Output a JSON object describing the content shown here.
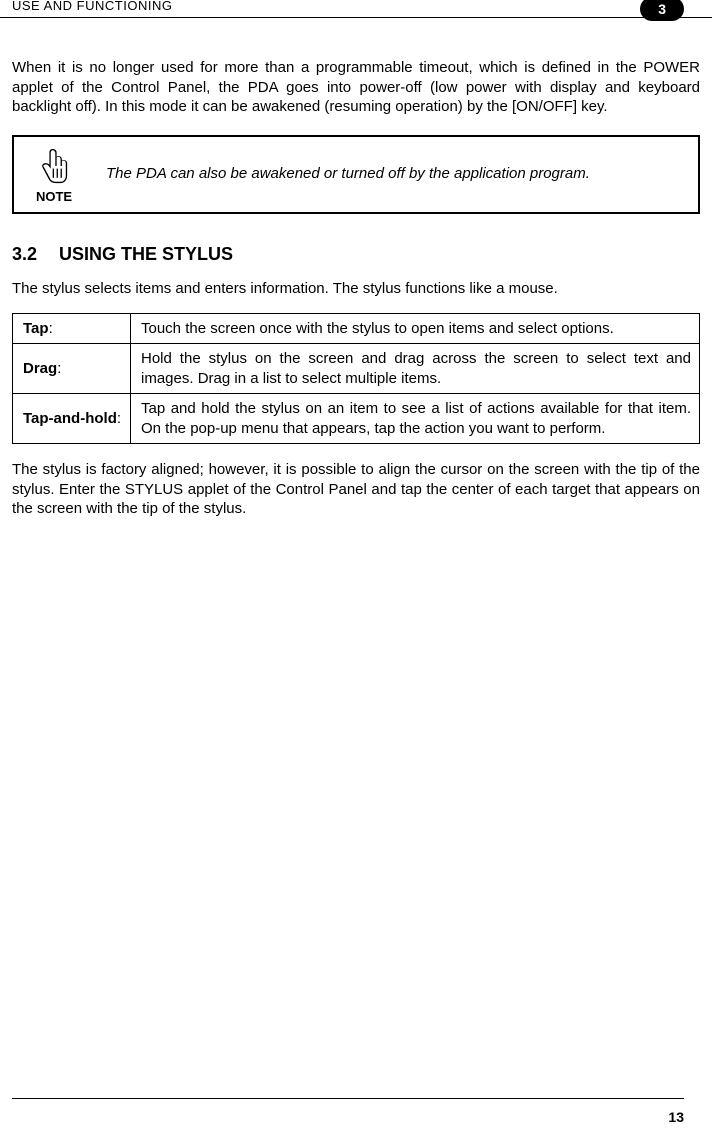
{
  "header": {
    "title": "USE AND FUNCTIONING",
    "chapterNumber": "3"
  },
  "body": {
    "intro": "When it is no longer used for more than a programmable timeout, which is defined in the POWER applet of the Control Panel, the PDA goes into power-off (low power with display and keyboard backlight off). In this mode it can be awakened (resuming operation) by the [ON/OFF] key.",
    "note": {
      "label": "NOTE",
      "text": "The PDA can also be awakened or turned off by the application program."
    },
    "section": {
      "number": "3.2",
      "title": "USING THE STYLUS",
      "intro": "The stylus selects items and enters information. The stylus functions like a mouse.",
      "definitions": [
        {
          "term": "Tap",
          "desc": "Touch the screen once with the stylus to open items and select options."
        },
        {
          "term": "Drag",
          "desc": "Hold the stylus on the screen and drag across the screen to select text and images. Drag in a list to select multiple items."
        },
        {
          "term": "Tap-and-hold",
          "desc": "Tap and hold the stylus on an item to see a list of actions available for that item. On the pop-up menu that appears, tap the action you want to perform."
        }
      ],
      "outro": "The stylus is factory aligned; however, it is possible to align the cursor on the screen with the tip of the stylus. Enter the STYLUS applet of the Control Panel and tap the center of each target that appears on the screen with the tip of the stylus."
    }
  },
  "footer": {
    "pageNumber": "13"
  }
}
